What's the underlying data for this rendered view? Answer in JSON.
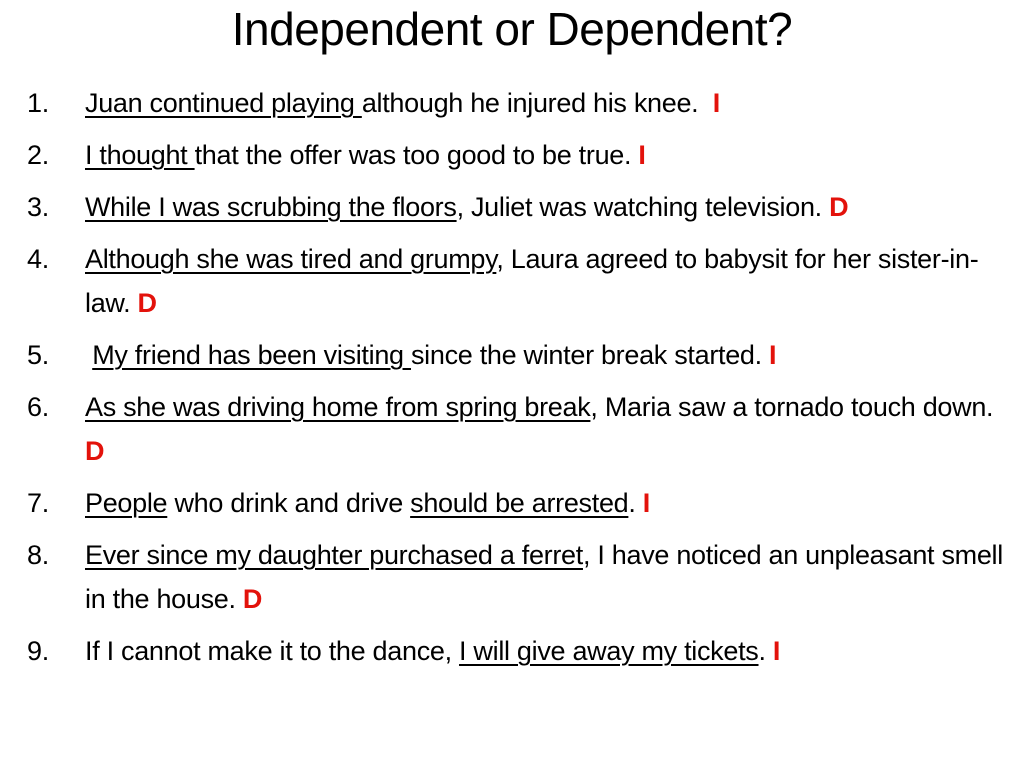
{
  "title": "Independent or Dependent?",
  "accent_color": "#e3120b",
  "items": [
    {
      "num": "1.",
      "segments": [
        {
          "text": "Juan continued playing ",
          "u": true
        },
        {
          "text": "although he injured his knee.  "
        }
      ],
      "mark": "I"
    },
    {
      "num": "2.",
      "segments": [
        {
          "text": "I thought ",
          "u": true
        },
        {
          "text": "that the offer was too good to be true. "
        }
      ],
      "mark": "I"
    },
    {
      "num": "3.",
      "segments": [
        {
          "text": "While I was scrubbing the floors",
          "u": true
        },
        {
          "text": ", Juliet was watching television. "
        }
      ],
      "mark": "D"
    },
    {
      "num": "4.",
      "segments": [
        {
          "text": "Although she was tired and grumpy",
          "u": true
        },
        {
          "text": ", Laura agreed to babysit for her sister-in-law. "
        }
      ],
      "mark": "D"
    },
    {
      "num": "5.",
      "segments": [
        {
          "text": " "
        },
        {
          "text": "My friend has been visiting ",
          "u": true
        },
        {
          "text": "since the winter break started. "
        }
      ],
      "mark": "I"
    },
    {
      "num": "6.",
      "segments": [
        {
          "text": "As she was driving home from spring break",
          "u": true
        },
        {
          "text": ", Maria saw a tornado touch down. "
        }
      ],
      "mark": "D"
    },
    {
      "num": "7.",
      "segments": [
        {
          "text": "People",
          "u": true
        },
        {
          "text": " who drink and drive "
        },
        {
          "text": "should be arrested",
          "u": true
        },
        {
          "text": ". "
        }
      ],
      "mark": "I"
    },
    {
      "num": "8.",
      "segments": [
        {
          "text": "Ever since my daughter purchased a ferret",
          "u": true
        },
        {
          "text": ", I have noticed an unpleasant smell in the house. "
        }
      ],
      "mark": "D"
    },
    {
      "num": "9.",
      "segments": [
        {
          "text": "If I cannot make it to the dance, "
        },
        {
          "text": "I will give away my tickets",
          "u": true
        },
        {
          "text": ". "
        }
      ],
      "mark": "I"
    }
  ]
}
